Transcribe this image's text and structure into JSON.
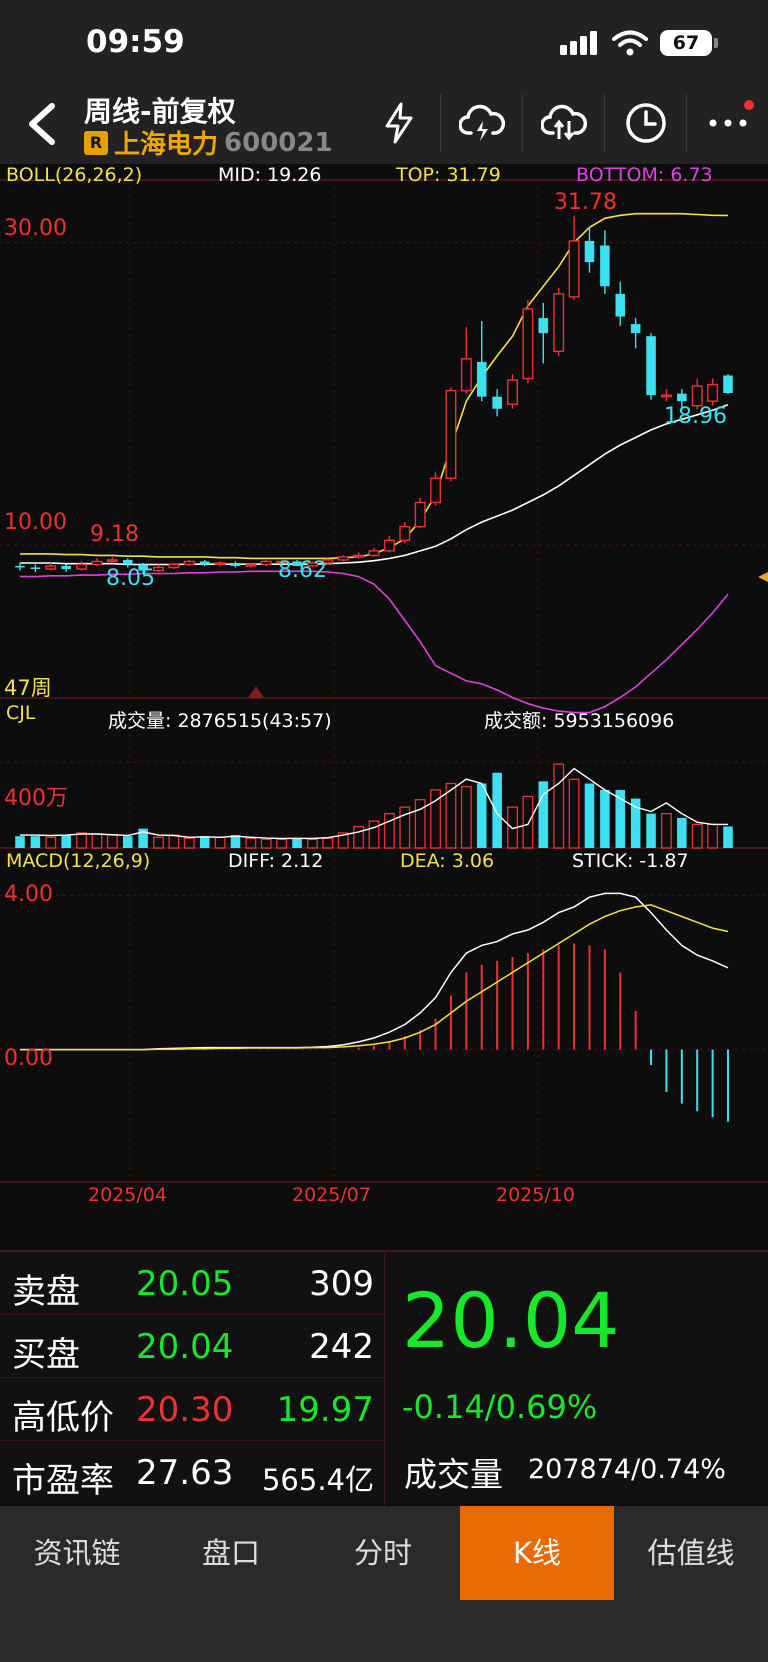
{
  "status": {
    "time": "09:59",
    "battery": "67"
  },
  "header": {
    "title": "周线-前复权",
    "badge": "R",
    "stock_name": "上海电力",
    "stock_code": "600021"
  },
  "boll": {
    "label": "BOLL(26,26,2)",
    "mid": "MID: 19.26",
    "top": "TOP: 31.79",
    "bottom": "BOTTOM: 6.73"
  },
  "kline": {
    "y_high_label": "30.00",
    "y_low_label": "10.00",
    "max_label": "31.78",
    "min_label_1": "9.18",
    "low_label_1": "8.05",
    "low_label_2": "8.62",
    "last_low_label": "18.96",
    "period_label": "47周"
  },
  "volume": {
    "label": "CJL",
    "vol": "成交量: 2876515(43:57)",
    "amount": "成交额: 5953156096",
    "y_label": "400万"
  },
  "macd": {
    "label": "MACD(12,26,9)",
    "diff": "DIFF: 2.12",
    "dea": "DEA: 3.06",
    "stick": "STICK: -1.87",
    "y_high": "4.00",
    "y_zero": "0.00"
  },
  "xaxis": {
    "labels": [
      "2025/04",
      "2025/07",
      "2025/10"
    ]
  },
  "quote": {
    "sell_label": "卖盘",
    "sell_price": "20.05",
    "sell_vol": "309",
    "buy_label": "买盘",
    "buy_price": "20.04",
    "buy_vol": "242",
    "hl_label": "高低价",
    "high": "20.30",
    "low": "19.97",
    "pe_label": "市盈率",
    "pe": "27.63",
    "mcap": "565.4亿",
    "price": "20.04",
    "change": "-0.14/0.69%",
    "vol_label": "成交量",
    "vol_value": "207874/0.74%"
  },
  "tabs": [
    {
      "label": "资讯链"
    },
    {
      "label": "盘口"
    },
    {
      "label": "分时"
    },
    {
      "label": "K线"
    },
    {
      "label": "估值线"
    }
  ],
  "chart_data": {
    "type": "candlestick",
    "interval": "weekly",
    "periods": 47,
    "x_tick_labels": [
      "2025/04",
      "2025/07",
      "2025/10"
    ],
    "candles": [
      {
        "o": 8.6,
        "c": 8.5,
        "h": 8.8,
        "l": 8.3
      },
      {
        "o": 8.5,
        "c": 8.4,
        "h": 8.7,
        "l": 8.2
      },
      {
        "o": 8.4,
        "c": 8.6,
        "h": 8.8,
        "l": 8.3
      },
      {
        "o": 8.6,
        "c": 8.4,
        "h": 8.7,
        "l": 8.2
      },
      {
        "o": 8.4,
        "c": 8.7,
        "h": 8.9,
        "l": 8.3
      },
      {
        "o": 8.7,
        "c": 8.9,
        "h": 9.1,
        "l": 8.6
      },
      {
        "o": 8.9,
        "c": 9.0,
        "h": 9.18,
        "l": 8.8
      },
      {
        "o": 9.0,
        "c": 8.7,
        "h": 9.1,
        "l": 8.5
      },
      {
        "o": 8.7,
        "c": 8.3,
        "h": 8.8,
        "l": 8.05
      },
      {
        "o": 8.3,
        "c": 8.5,
        "h": 8.7,
        "l": 8.2
      },
      {
        "o": 8.5,
        "c": 8.7,
        "h": 8.8,
        "l": 8.4
      },
      {
        "o": 8.7,
        "c": 8.9,
        "h": 9.0,
        "l": 8.6
      },
      {
        "o": 8.9,
        "c": 8.7,
        "h": 9.0,
        "l": 8.6
      },
      {
        "o": 8.7,
        "c": 8.8,
        "h": 8.9,
        "l": 8.6
      },
      {
        "o": 8.8,
        "c": 8.6,
        "h": 8.9,
        "l": 8.5
      },
      {
        "o": 8.6,
        "c": 8.7,
        "h": 8.8,
        "l": 8.5
      },
      {
        "o": 8.7,
        "c": 8.9,
        "h": 9.0,
        "l": 8.6
      },
      {
        "o": 8.9,
        "c": 8.9,
        "h": 9.0,
        "l": 8.8
      },
      {
        "o": 8.9,
        "c": 8.6,
        "h": 9.0,
        "l": 8.62
      },
      {
        "o": 8.6,
        "c": 8.8,
        "h": 8.9,
        "l": 8.6
      },
      {
        "o": 8.8,
        "c": 9.0,
        "h": 9.1,
        "l": 8.7
      },
      {
        "o": 9.0,
        "c": 9.2,
        "h": 9.3,
        "l": 8.9
      },
      {
        "o": 9.2,
        "c": 9.3,
        "h": 9.5,
        "l": 9.1
      },
      {
        "o": 9.3,
        "c": 9.6,
        "h": 9.8,
        "l": 9.2
      },
      {
        "o": 9.6,
        "c": 10.3,
        "h": 10.6,
        "l": 9.5
      },
      {
        "o": 10.3,
        "c": 11.2,
        "h": 11.5,
        "l": 10.1
      },
      {
        "o": 11.2,
        "c": 12.8,
        "h": 13.1,
        "l": 11.1
      },
      {
        "o": 12.8,
        "c": 14.4,
        "h": 14.8,
        "l": 12.6
      },
      {
        "o": 14.4,
        "c": 20.2,
        "h": 20.4,
        "l": 14.2
      },
      {
        "o": 20.2,
        "c": 22.3,
        "h": 24.4,
        "l": 20.0
      },
      {
        "o": 22.1,
        "c": 19.8,
        "h": 24.8,
        "l": 19.5
      },
      {
        "o": 19.8,
        "c": 19.0,
        "h": 20.3,
        "l": 18.5
      },
      {
        "o": 19.3,
        "c": 20.9,
        "h": 21.3,
        "l": 19.0
      },
      {
        "o": 21.0,
        "c": 25.6,
        "h": 26.2,
        "l": 20.7
      },
      {
        "o": 25.0,
        "c": 24.0,
        "h": 26.0,
        "l": 22.0
      },
      {
        "o": 22.8,
        "c": 26.6,
        "h": 27.0,
        "l": 22.5
      },
      {
        "o": 26.4,
        "c": 30.1,
        "h": 31.78,
        "l": 26.2
      },
      {
        "o": 30.1,
        "c": 28.7,
        "h": 31.0,
        "l": 28.0
      },
      {
        "o": 29.8,
        "c": 27.1,
        "h": 30.8,
        "l": 26.6
      },
      {
        "o": 26.6,
        "c": 25.1,
        "h": 27.4,
        "l": 24.5
      },
      {
        "o": 24.6,
        "c": 24.0,
        "h": 25.0,
        "l": 23.0
      },
      {
        "o": 23.8,
        "c": 19.9,
        "h": 24.0,
        "l": 19.6
      },
      {
        "o": 19.8,
        "c": 19.9,
        "h": 20.3,
        "l": 19.5
      },
      {
        "o": 20.0,
        "c": 19.5,
        "h": 20.3,
        "l": 19.0
      },
      {
        "o": 19.2,
        "c": 20.5,
        "h": 21.0,
        "l": 18.96
      },
      {
        "o": 19.5,
        "c": 20.6,
        "h": 21.0,
        "l": 19.2
      },
      {
        "o": 21.2,
        "c": 20.04,
        "h": 21.3,
        "l": 19.97
      }
    ],
    "boll_mid": [
      8.8,
      8.8,
      8.8,
      8.75,
      8.75,
      8.75,
      8.75,
      8.7,
      8.7,
      8.7,
      8.7,
      8.72,
      8.72,
      8.72,
      8.72,
      8.72,
      8.72,
      8.72,
      8.72,
      8.72,
      8.75,
      8.8,
      8.85,
      8.95,
      9.1,
      9.3,
      9.6,
      9.9,
      10.4,
      11.0,
      11.5,
      11.9,
      12.3,
      12.8,
      13.3,
      13.9,
      14.6,
      15.3,
      16.0,
      16.6,
      17.1,
      17.6,
      18.0,
      18.3,
      18.6,
      18.9,
      19.26
    ],
    "boll_top": [
      9.4,
      9.4,
      9.4,
      9.35,
      9.35,
      9.3,
      9.3,
      9.25,
      9.25,
      9.2,
      9.2,
      9.2,
      9.2,
      9.15,
      9.15,
      9.1,
      9.1,
      9.1,
      9.1,
      9.1,
      9.1,
      9.15,
      9.2,
      9.4,
      9.8,
      10.4,
      11.6,
      13.3,
      16.5,
      19.5,
      21.1,
      22.5,
      23.8,
      25.8,
      27.1,
      28.4,
      30.0,
      31.0,
      31.6,
      31.8,
      31.9,
      31.9,
      31.9,
      31.9,
      31.85,
      31.8,
      31.79
    ],
    "boll_bottom": [
      7.9,
      7.9,
      7.95,
      7.95,
      8.0,
      8.0,
      8.05,
      8.05,
      8.1,
      8.1,
      8.1,
      8.15,
      8.15,
      8.2,
      8.2,
      8.25,
      8.25,
      8.25,
      8.25,
      8.25,
      8.2,
      8.1,
      7.9,
      7.4,
      6.4,
      5.0,
      3.6,
      2.0,
      1.5,
      1.0,
      0.8,
      0.4,
      -0.1,
      -0.5,
      -0.8,
      -1.0,
      -1.1,
      -1.1,
      -0.7,
      -0.1,
      0.6,
      1.5,
      2.4,
      3.4,
      4.4,
      5.5,
      6.73
    ],
    "volume": [
      55,
      55,
      50,
      60,
      70,
      65,
      60,
      55,
      90,
      50,
      60,
      45,
      55,
      50,
      60,
      45,
      40,
      40,
      45,
      40,
      45,
      70,
      100,
      125,
      160,
      190,
      225,
      270,
      300,
      285,
      300,
      350,
      190,
      240,
      310,
      390,
      320,
      300,
      270,
      270,
      230,
      160,
      160,
      140,
      110,
      110,
      100
    ],
    "volume_amount_line": [
      60,
      60,
      58,
      60,
      65,
      65,
      62,
      58,
      75,
      60,
      58,
      50,
      52,
      50,
      55,
      50,
      46,
      44,
      45,
      44,
      48,
      60,
      75,
      95,
      125,
      155,
      180,
      220,
      270,
      320,
      300,
      160,
      90,
      110,
      250,
      300,
      370,
      320,
      270,
      230,
      190,
      170,
      210,
      160,
      120,
      110,
      110
    ],
    "macd_stick": [
      0,
      0,
      0,
      0,
      0,
      0,
      0,
      0,
      0,
      0,
      0,
      0,
      0,
      0,
      0,
      0,
      0,
      0,
      0,
      0,
      0,
      0,
      0.05,
      0.1,
      0.2,
      0.35,
      0.5,
      0.8,
      1.4,
      2.0,
      2.2,
      2.3,
      2.4,
      2.5,
      2.6,
      2.7,
      2.75,
      2.7,
      2.6,
      2.0,
      1.0,
      -0.4,
      -1.1,
      -1.4,
      -1.6,
      -1.75,
      -1.87
    ],
    "macd_diff": [
      0,
      0,
      0,
      0,
      0,
      0,
      0,
      0,
      0,
      0.02,
      0.03,
      0.04,
      0.05,
      0.05,
      0.05,
      0.05,
      0.05,
      0.05,
      0.05,
      0.06,
      0.08,
      0.12,
      0.2,
      0.3,
      0.45,
      0.65,
      0.95,
      1.35,
      2.0,
      2.5,
      2.7,
      2.8,
      3.0,
      3.1,
      3.3,
      3.55,
      3.7,
      3.95,
      4.05,
      4.05,
      3.95,
      3.55,
      3.1,
      2.7,
      2.45,
      2.3,
      2.12
    ],
    "macd_dea": [
      0,
      0,
      0,
      0,
      0,
      0,
      0,
      0,
      0,
      0.01,
      0.01,
      0.02,
      0.02,
      0.03,
      0.03,
      0.04,
      0.04,
      0.04,
      0.04,
      0.05,
      0.05,
      0.07,
      0.1,
      0.14,
      0.2,
      0.3,
      0.45,
      0.65,
      0.95,
      1.25,
      1.5,
      1.75,
      2.0,
      2.25,
      2.5,
      2.75,
      3.0,
      3.25,
      3.45,
      3.6,
      3.7,
      3.75,
      3.6,
      3.45,
      3.3,
      3.15,
      3.06
    ],
    "boll_ylim": [
      0,
      34
    ],
    "volume_ylim": [
      0,
      400
    ],
    "macd_ylim": [
      -2.5,
      4.5
    ]
  }
}
